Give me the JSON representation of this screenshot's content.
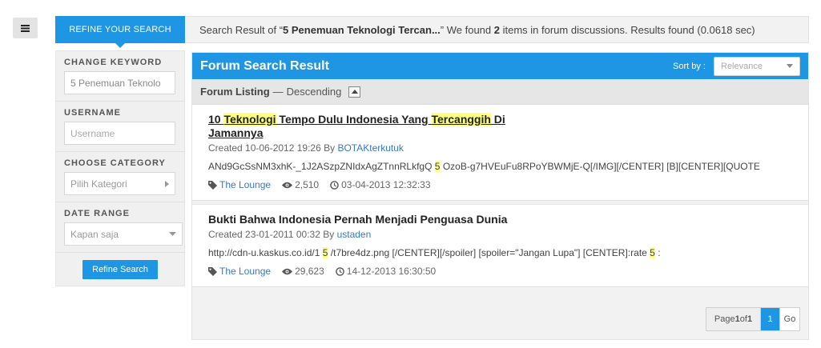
{
  "topbar": {
    "refine_tab": "REFINE YOUR SEARCH",
    "summary_prefix": "Search Result of “",
    "query": "5 Penemuan Teknologi Tercan...",
    "summary_mid": "” We found ",
    "count": "2",
    "summary_suffix": " items in forum discussions. Results found (0.0618 sec)"
  },
  "sidebar": {
    "keyword_label": "CHANGE KEYWORD",
    "keyword_value": "5 Penemuan Teknolo",
    "username_label": "USERNAME",
    "username_placeholder": "Username",
    "category_label": "CHOOSE CATEGORY",
    "category_value": "Pilih Kategori",
    "date_label": "DATE RANGE",
    "date_value": "Kapan saja",
    "refine_button": "Refine Search"
  },
  "main": {
    "title": "Forum Search Result",
    "sort_label": "Sort by :",
    "sort_value": "Relevance",
    "listing_label": "Forum Listing",
    "listing_sep": "—",
    "listing_order": "Descending"
  },
  "results": [
    {
      "title_parts": [
        "10 ",
        "Teknologi",
        " Tempo Dulu Indonesia Yang ",
        "Tercanggih",
        " Di Jamannya"
      ],
      "created_prefix": "Created 10-06-2012 19:26 By ",
      "author": "BOTAKterkutuk",
      "snippet_parts": [
        "ANd9GcSsNM3xhK-_1J2ASzpZNIdxAgZTnnRLkfgQ",
        "5",
        "OzoB-g7HVEuFu8RPoYBWMjE-Q[/IMG][/CENTER] [B][CENTER][QUOTE"
      ],
      "forum": "The Lounge",
      "views": "2,510",
      "last_post": "03-04-2013 12:32:33"
    },
    {
      "title_parts": [
        "Bukti Bahwa Indonesia Pernah Menjadi Penguasa Dunia"
      ],
      "created_prefix": "Created 23-01-2011 00:32 By ",
      "author": "ustaden",
      "snippet_parts": [
        "http://cdn-u.kaskus.co.id/1",
        "5",
        "/t7bre4dz.png [/CENTER][/spoiler] [spoiler=\"Jangan Lupa\"] [CENTER]:rate",
        "5",
        ":"
      ],
      "forum": "The Lounge",
      "views": "29,623",
      "last_post": "14-12-2013 16:30:50"
    }
  ],
  "pager": {
    "page_prefix": "Page ",
    "page_current": "1",
    "page_of": " of ",
    "page_total": "1",
    "current_button": "1",
    "go_button": "Go"
  },
  "icons": {
    "menu": "hamburger-icon",
    "forum": "tag-icon",
    "views": "eye-icon",
    "time": "clock-icon",
    "collapse": "caret-up-icon"
  },
  "colors": {
    "accent": "#1e96e4",
    "highlight": "#ffff80",
    "link": "#3a79b8"
  }
}
